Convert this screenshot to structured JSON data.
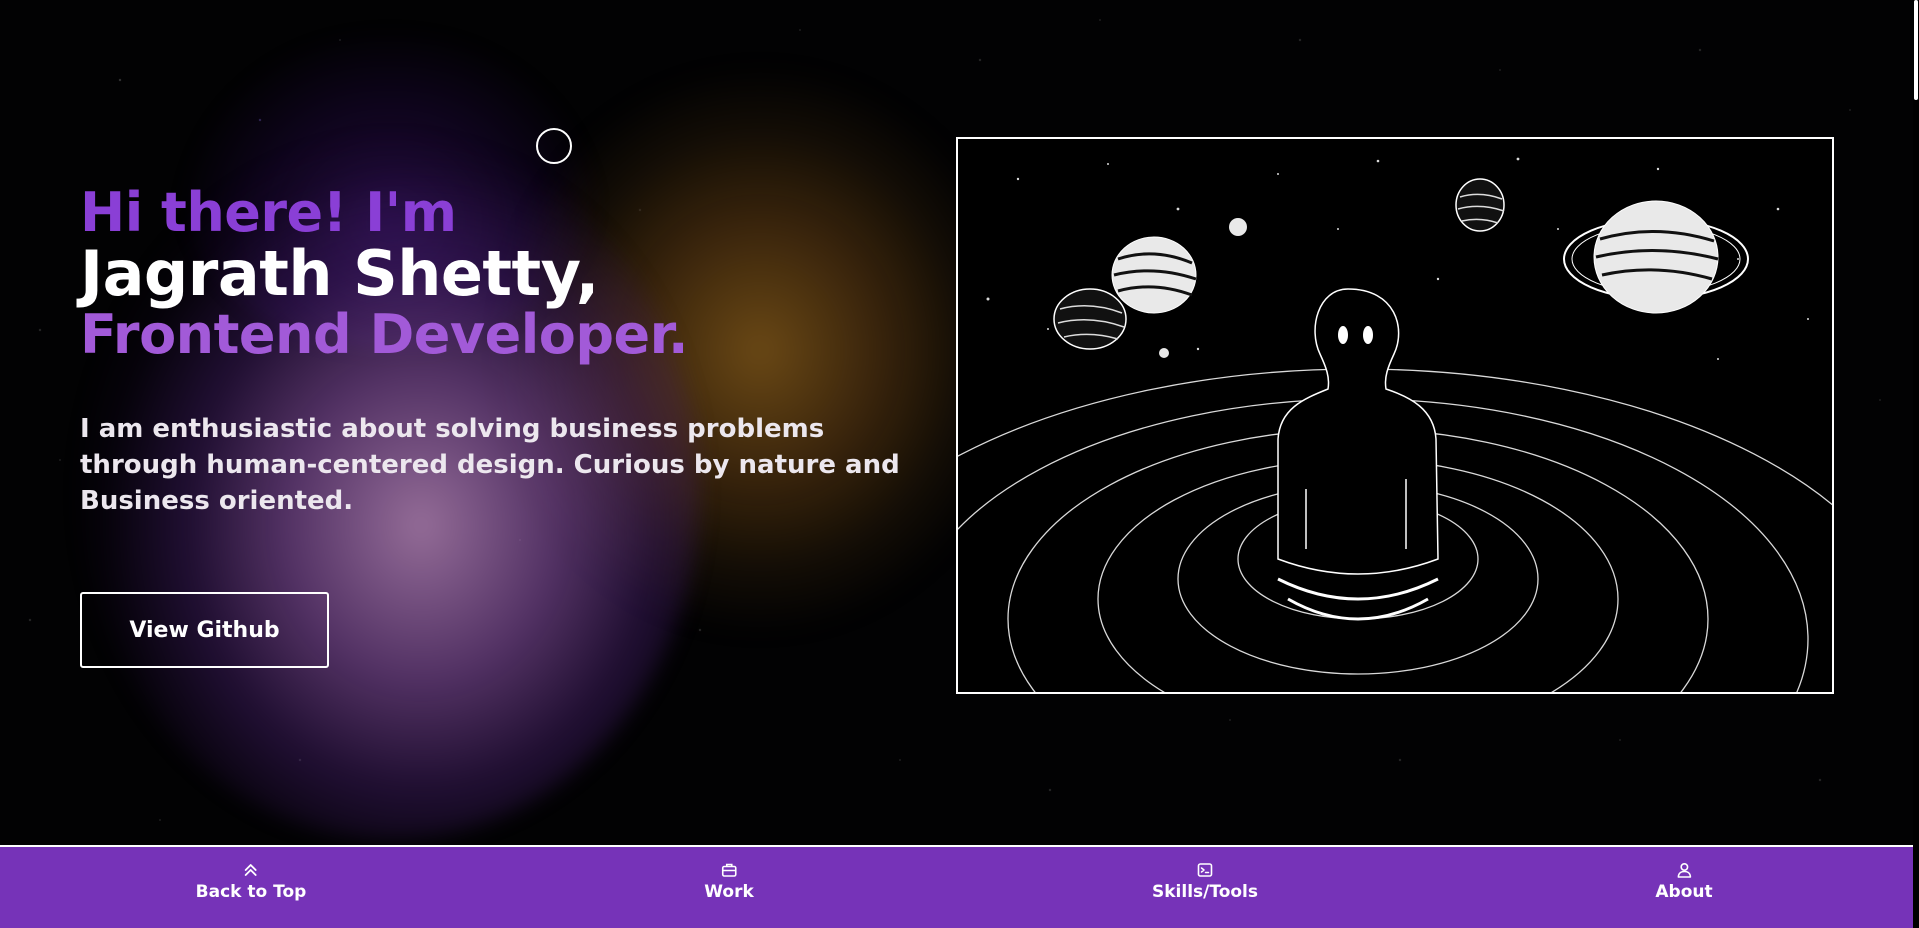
{
  "hero": {
    "greeting": "Hi there! I'm",
    "name": "Jagrath Shetty,",
    "role": "Frontend Developer.",
    "tagline": "I am enthusiastic about solving business problems through human-centered design. Curious by nature and Business oriented.",
    "github_button": "View Github"
  },
  "illustration": {
    "icon": "astronaut-in-space-illustration"
  },
  "bottom_nav": {
    "items": [
      {
        "label": "Back to Top",
        "icon": "chevrons-up-icon"
      },
      {
        "label": "Work",
        "icon": "briefcase-icon"
      },
      {
        "label": "Skills/Tools",
        "icon": "terminal-icon"
      },
      {
        "label": "About",
        "icon": "user-icon"
      }
    ]
  },
  "colors": {
    "accent_purple": "#7633b8",
    "greeting": "#8a3fd6",
    "role": "#a25ad8",
    "text": "#ffffff"
  }
}
